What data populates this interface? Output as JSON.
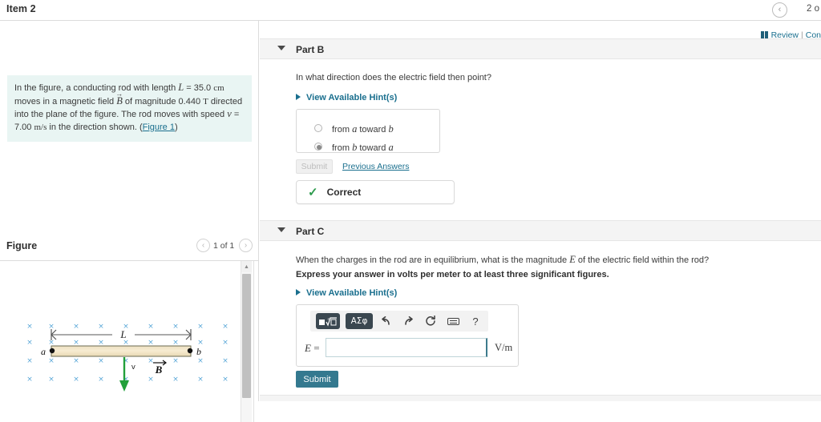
{
  "topbar": {
    "item_title": "Item 2",
    "prev_icon": "chevron-left-icon",
    "nav_count": "2 o"
  },
  "meta": {
    "book_icon": "book-icon",
    "review_label": "Review",
    "separator": "|",
    "constants_label": "Con"
  },
  "prompt": {
    "line1_a": "In the figure, a conducting rod with length ",
    "symbol_L": "L",
    "line1_b": " = 35.0 ",
    "unit_cm": "cm",
    "line1_c": " moves in a",
    "line2_a": "magnetic field ",
    "symbol_B": "B",
    "line2_b": " of magnitude 0.440 ",
    "unit_T": "T",
    "line2_c": " directed into the plane of the",
    "line3_a": "figure. The rod moves with speed ",
    "symbol_v": "v",
    "line3_b": " = 7.00 ",
    "unit_ms": "m/s",
    "line3_c": " in the direction shown. (",
    "figure_link": "Figure 1",
    "line3_d": ")"
  },
  "figure": {
    "title": "Figure",
    "prev_icon": "chevron-left-icon",
    "next_icon": "chevron-right-icon",
    "count": "1 of 1",
    "scroll_up_icon": "triangle-up-icon",
    "diagram": {
      "length_label": "L",
      "point_a": "a",
      "point_b": "b",
      "velocity_label": "v",
      "field_label": "B",
      "field_symbol": "×",
      "field_color": "#5aa8d8",
      "rod_fill": "#f3e3c3",
      "rod_border": "#6b6b52",
      "velocity_color": "#22a03a",
      "rows": 4,
      "cols": 9
    }
  },
  "partB": {
    "caret_icon": "caret-down-icon",
    "label": "Part B",
    "question": "In what direction does the electric field then point?",
    "hint_label": "View Available Hint(s)",
    "hint_caret_icon": "caret-right-icon",
    "options": [
      {
        "prefix": "from ",
        "var1": "a",
        "mid": " toward ",
        "var2": "b",
        "checked": false
      },
      {
        "prefix": "from ",
        "var1": "b",
        "mid": " toward ",
        "var2": "a",
        "checked": true
      }
    ],
    "submit_label": "Submit",
    "previous_answers_label": "Previous Answers",
    "feedback_icon": "check-icon",
    "feedback_label": "Correct"
  },
  "partC": {
    "caret_icon": "caret-down-icon",
    "label": "Part C",
    "question_a": "When the charges in the rod are in equilibrium, what is the magnitude ",
    "question_var": "E",
    "question_b": " of the electric field within the rod?",
    "instruction": "Express your answer in volts per meter to at least three significant figures.",
    "hint_label": "View Available Hint(s)",
    "hint_caret_icon": "caret-right-icon",
    "toolbar": {
      "template_icon": "math-template-icon",
      "greek_label": "ΑΣφ",
      "undo_icon": "undo-arrow-icon",
      "redo_icon": "redo-arrow-icon",
      "reset_icon": "refresh-icon",
      "keyboard_icon": "keyboard-icon",
      "help_label": "?"
    },
    "answer_var": "E",
    "answer_equals": "=",
    "answer_value": "",
    "units_label": "V/m",
    "submit_label": "Submit"
  }
}
